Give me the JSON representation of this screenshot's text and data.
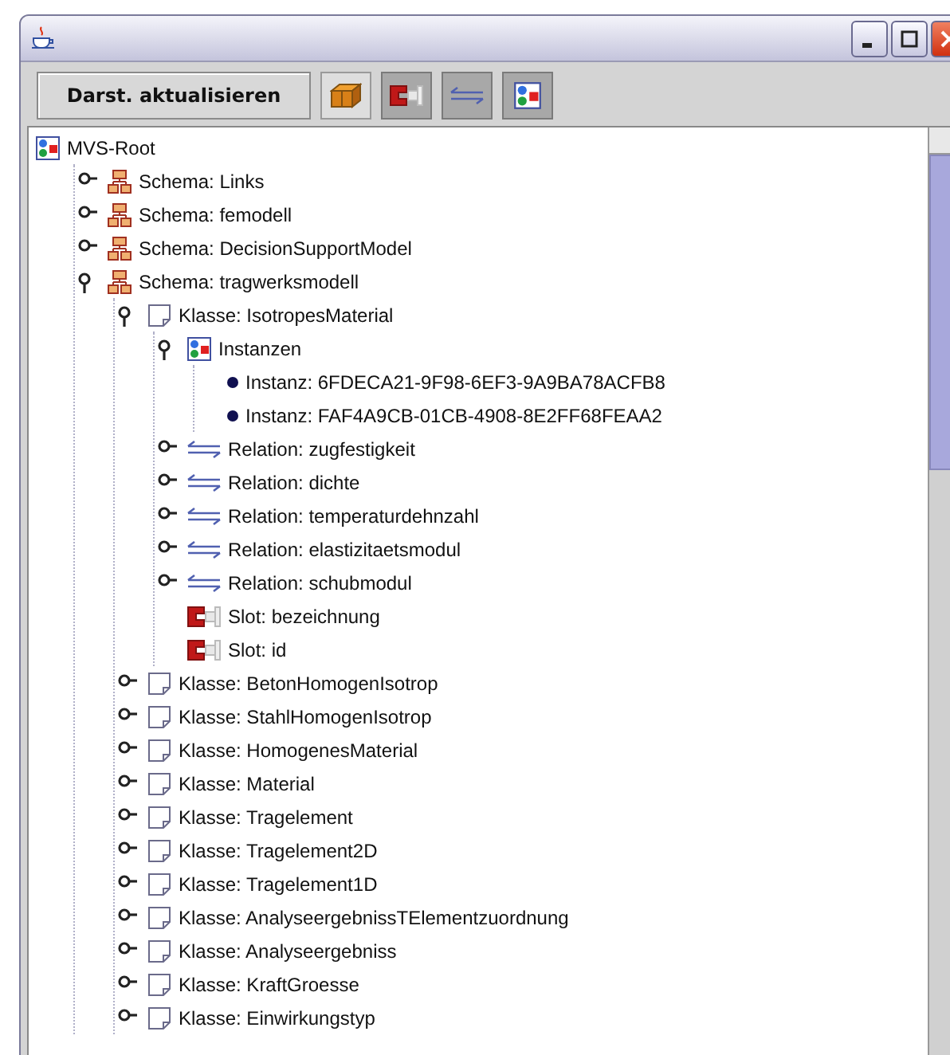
{
  "toolbar": {
    "refresh_button": "Darst. aktualisieren",
    "toggles": [
      {
        "kind": "class",
        "selected": false
      },
      {
        "kind": "slot",
        "selected": true
      },
      {
        "kind": "relation",
        "selected": true
      },
      {
        "kind": "instances",
        "selected": true
      }
    ]
  },
  "tree": [
    {
      "kind": "root",
      "label": "MVS-Root",
      "children": [
        {
          "kind": "schema",
          "label": "Schema: Links",
          "expanded": false
        },
        {
          "kind": "schema",
          "label": "Schema: femodell",
          "expanded": false
        },
        {
          "kind": "schema",
          "label": "Schema: DecisionSupportModel",
          "expanded": false
        },
        {
          "kind": "schema",
          "label": "Schema: tragwerksmodell",
          "expanded": true,
          "children": [
            {
              "kind": "class",
              "label": "Klasse: IsotropesMaterial",
              "expanded": true,
              "children": [
                {
                  "kind": "instances",
                  "label": "Instanzen",
                  "expanded": true,
                  "children": [
                    {
                      "kind": "instance",
                      "label": "Instanz: 6FDECA21-9F98-6EF3-9A9BA78ACFB8"
                    },
                    {
                      "kind": "instance",
                      "label": "Instanz: FAF4A9CB-01CB-4908-8E2FF68FEAA2"
                    }
                  ]
                },
                {
                  "kind": "relation",
                  "label": "Relation: zugfestigkeit",
                  "expanded": false
                },
                {
                  "kind": "relation",
                  "label": "Relation: dichte",
                  "expanded": false
                },
                {
                  "kind": "relation",
                  "label": "Relation: temperaturdehnzahl",
                  "expanded": false
                },
                {
                  "kind": "relation",
                  "label": "Relation: elastizitaetsmodul",
                  "expanded": false
                },
                {
                  "kind": "relation",
                  "label": "Relation: schubmodul",
                  "expanded": false
                },
                {
                  "kind": "slot",
                  "label": "Slot: bezeichnung"
                },
                {
                  "kind": "slot",
                  "label": "Slot: id"
                }
              ]
            },
            {
              "kind": "class",
              "label": "Klasse: BetonHomogenIsotrop",
              "expanded": false
            },
            {
              "kind": "class",
              "label": "Klasse: StahlHomogenIsotrop",
              "expanded": false
            },
            {
              "kind": "class",
              "label": "Klasse: HomogenesMaterial",
              "expanded": false
            },
            {
              "kind": "class",
              "label": "Klasse: Material",
              "expanded": false
            },
            {
              "kind": "class",
              "label": "Klasse: Tragelement",
              "expanded": false
            },
            {
              "kind": "class",
              "label": "Klasse: Tragelement2D",
              "expanded": false
            },
            {
              "kind": "class",
              "label": "Klasse: Tragelement1D",
              "expanded": false
            },
            {
              "kind": "class",
              "label": "Klasse: AnalyseergebnissTElementzuordnung",
              "expanded": false
            },
            {
              "kind": "class",
              "label": "Klasse: Analyseergebniss",
              "expanded": false
            },
            {
              "kind": "class",
              "label": "Klasse: KraftGroesse",
              "expanded": false
            },
            {
              "kind": "class",
              "label": "Klasse: Einwirkungstyp",
              "expanded": false
            }
          ]
        }
      ]
    }
  ]
}
